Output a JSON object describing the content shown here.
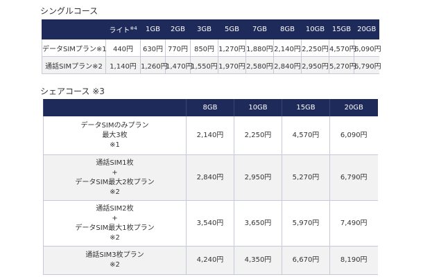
{
  "single": {
    "heading": "シングルコース",
    "headers": [
      "",
      "ライト",
      "1GB",
      "2GB",
      "3GB",
      "5GB",
      "7GB",
      "8GB",
      "10GB",
      "15GB",
      "20GB"
    ],
    "lite_note": "※4",
    "rows": [
      {
        "plan": "データSIMプラン※1",
        "cells": [
          "440円",
          "630円",
          "770円",
          "850円",
          "1,270円",
          "1,880円",
          "2,140円",
          "2,250円",
          "4,570円",
          "6,090円"
        ]
      },
      {
        "plan": "通話SIMプラン※2",
        "cells": [
          "1,140円",
          "1,260円",
          "1,470円",
          "1,550円",
          "1,970円",
          "2,580円",
          "2,840円",
          "2,950円",
          "5,270円",
          "6,790円"
        ]
      }
    ]
  },
  "share": {
    "heading": "シェアコース ※3",
    "headers": [
      "",
      "8GB",
      "10GB",
      "15GB",
      "20GB"
    ],
    "rows": [
      {
        "plan": [
          "データSIMのみプラン",
          "最大3枚",
          "※1"
        ],
        "cells": [
          "2,140円",
          "2,250円",
          "4,570円",
          "6,090円"
        ]
      },
      {
        "plan": [
          "通話SIM1枚",
          "+",
          "データSIM最大2枚プラン",
          "※2"
        ],
        "cells": [
          "2,840円",
          "2,950円",
          "5,270円",
          "6,790円"
        ]
      },
      {
        "plan": [
          "通話SIM2枚",
          "+",
          "データSIM最大1枚プラン",
          "※2"
        ],
        "cells": [
          "3,540円",
          "3,650円",
          "5,970円",
          "7,490円"
        ]
      },
      {
        "plan": [
          "通話SIM3枚プラン",
          "※2"
        ],
        "cells": [
          "4,240円",
          "4,350円",
          "6,670円",
          "8,190円"
        ]
      }
    ]
  },
  "colors": {
    "header_bg": "#1e2a5a",
    "alt_row": "#f2f2f2",
    "border": "#c6cad6"
  }
}
